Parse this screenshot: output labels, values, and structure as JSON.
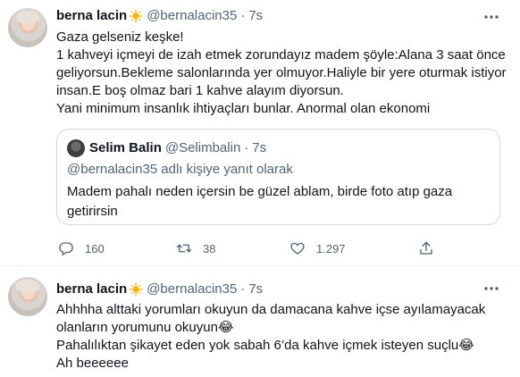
{
  "tweets": [
    {
      "name": "berna lacin",
      "handle": "@bernalacin35",
      "separator": "·",
      "time": "7s",
      "lines": [
        "Gaza gelseniz keşke!",
        "1 kahveyi içmeyi de izah etmek zorundayız madem şöyle:Alana 3 saat önce",
        "geliyorsun.Bekleme salonlarında yer olmuyor.Haliyle bir yere oturmak istiyor",
        "insan.E boş olmaz bari 1 kahve alayım diyorsun.",
        "Yani minimum insanlık ihtiyaçları bunlar. Anormal olan ekonomi"
      ],
      "quote": {
        "name": "Selim Balin",
        "handle": "@Selimbalin",
        "separator": "·",
        "time": "7s",
        "reply_to": "@bernalacin35 adlı kişiye yanıt olarak",
        "text": "Madem pahalı neden içersin be güzel ablam, birde foto atıp gaza getirirsin"
      },
      "actions": {
        "replies": "160",
        "retweets": "38",
        "likes": "1.297"
      }
    },
    {
      "name": "berna lacin",
      "handle": "@bernalacin35",
      "separator": "·",
      "time": "7s",
      "lines": [
        "Ahhhha alttaki yorumları okuyun da damacana kahve içse ayılamayacak",
        "olanların yorumunu okuyun😂",
        "Pahalılıktan şikayet eden yok sabah 6’da kahve içmek isteyen suçlu😂",
        "Ah beeeeee"
      ]
    }
  ],
  "icons": {
    "badge": "sun-badge-icon",
    "more": "more-dots-icon",
    "reply": "reply-icon",
    "retweet": "retweet-icon",
    "like": "heart-icon",
    "share": "share-icon"
  },
  "colors": {
    "text": "#0f1419",
    "secondary": "#536471",
    "border": "#cfd9de",
    "badge": "#f4b400"
  }
}
